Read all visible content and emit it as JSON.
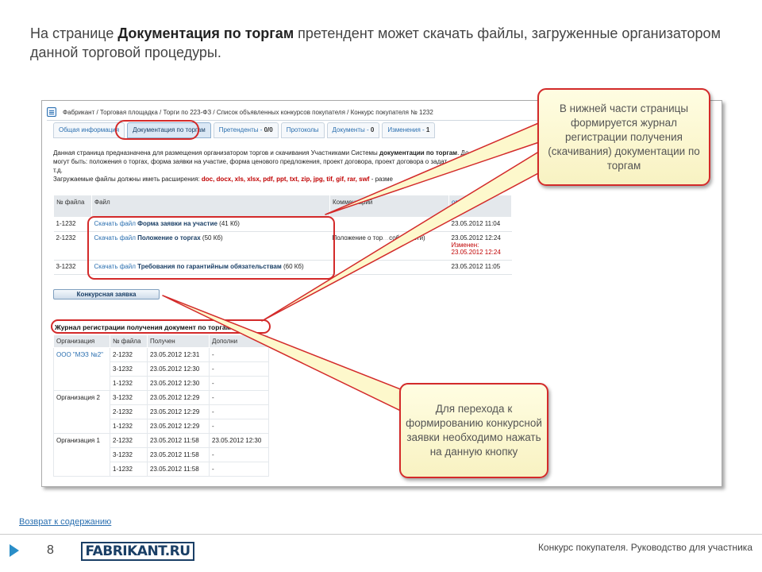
{
  "intro": {
    "prefix": "На странице ",
    "highlight": "Документация по торгам",
    "suffix": " претендент может скачать файлы, загруженные организатором данной торговой процедуры."
  },
  "screenshot": {
    "breadcrumb": "Фабрикант / Торговая площадка / Торги по 223-ФЗ / Список объявленных конкурсов покупателя / Конкурс покупателя № 1232",
    "tabs": [
      {
        "label": "Общая информация",
        "count": ""
      },
      {
        "label": "Документация по торгам",
        "count": ""
      },
      {
        "label": "Претенденты - ",
        "count": "0/0"
      },
      {
        "label": "Протоколы",
        "count": ""
      },
      {
        "label": "Документы - ",
        "count": "0"
      },
      {
        "label": "Изменения - ",
        "count": "1"
      }
    ],
    "desc_line1_a": "Данная страница предназначена для размещения организатором торгов и скачивания Участниками Системы ",
    "desc_line1_b": "документации по торгам",
    "desc_line1_c": ". До",
    "desc_line2": "могут быть: положения о торгах, форма заявки на участие, форма ценового предложения, проект договора, проект договора о задат",
    "desc_line3": "т.д.",
    "desc_ext_label": "Загружаемые файлы должны иметь расширения: ",
    "desc_ext": "doc, docx, xls, xlsx, pdf, ppt, txt, zip, jpg, tif, gif, rar, swf",
    "desc_ext_tail": " - разме",
    "files_headers": {
      "num": "№ файла",
      "file": "Файл",
      "comment": "Комментарий",
      "date_line1": "ован",
      "date_line2": "енен"
    },
    "files": [
      {
        "num": "1-1232",
        "prefix": "Скачать файл ",
        "name": "Форма заявки на участие",
        "size": " (41 Кб)",
        "comment": "",
        "date": "23.05.2012 11:04",
        "changed_label": "",
        "changed_date": ""
      },
      {
        "num": "2-1232",
        "prefix": "Скачать файл ",
        "name": "Положение о торгах",
        "size": " (50 Кб)",
        "comment": "Положение о тор",
        "comment_tail": "собенности)",
        "date": "23.05.2012 12:24",
        "changed_label": "Изменен:",
        "changed_date": "23.05.2012 12:24"
      },
      {
        "num": "3-1232",
        "prefix": "Скачать файл ",
        "name": "Требования по гарантийным обязательствам",
        "size": " (60 Кб)",
        "comment": "",
        "date": "23.05.2012 11:05",
        "changed_label": "",
        "changed_date": ""
      }
    ],
    "apply_button": "Конкурсная заявка",
    "journal_title": "Журнал регистрации получения документ",
    "journal_title_tail": "по торгам",
    "journal_headers": {
      "org": "Организация",
      "num": "№ файла",
      "received": "Получен",
      "extra": "Дополни"
    },
    "journal": [
      {
        "org": "ООО \"МЭЗ №2\"",
        "org_link": true,
        "rows": [
          {
            "num": "2-1232",
            "received": "23.05.2012 12:31",
            "extra": "-"
          },
          {
            "num": "3-1232",
            "received": "23.05.2012 12:30",
            "extra": "-"
          },
          {
            "num": "1-1232",
            "received": "23.05.2012 12:30",
            "extra": "-"
          }
        ]
      },
      {
        "org": "Организация 2",
        "org_link": false,
        "rows": [
          {
            "num": "3-1232",
            "received": "23.05.2012 12:29",
            "extra": "-"
          },
          {
            "num": "2-1232",
            "received": "23.05.2012 12:29",
            "extra": "-"
          },
          {
            "num": "1-1232",
            "received": "23.05.2012 12:29",
            "extra": "-"
          }
        ]
      },
      {
        "org": "Организация 1",
        "org_link": false,
        "rows": [
          {
            "num": "2-1232",
            "received": "23.05.2012 11:58",
            "extra": "23.05.2012 12:30"
          },
          {
            "num": "3-1232",
            "received": "23.05.2012 11:58",
            "extra": "-"
          },
          {
            "num": "1-1232",
            "received": "23.05.2012 11:58",
            "extra": "-"
          }
        ]
      }
    ]
  },
  "callouts": {
    "top": "В нижней части страницы формируется журнал регистрации получения (скачивания) документации по торгам",
    "bottom": "Для перехода к формированию конкурсной заявки необходимо нажать на данную кнопку"
  },
  "back_link": "Возврат к содержанию",
  "footer": {
    "page_number": "8",
    "logo": "FABRIKANT.RU",
    "text": "Конкурс покупателя. Руководство для участника"
  },
  "colors": {
    "accent_red": "#d32a2a",
    "link_blue": "#2a6fb0",
    "callout_fill": "#fffde2"
  }
}
